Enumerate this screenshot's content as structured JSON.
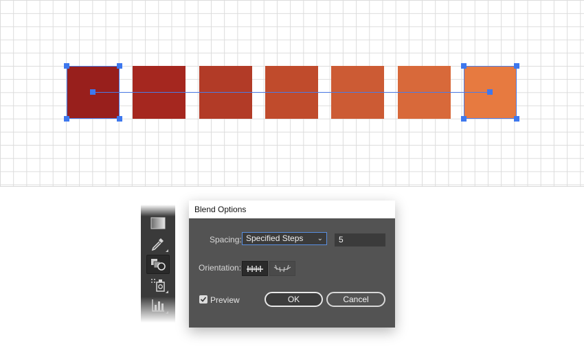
{
  "canvas": {
    "blend_colors": [
      "#981f1c",
      "#a5271f",
      "#b23b27",
      "#c04b2c",
      "#cc5b34",
      "#d8693a",
      "#e77a40"
    ],
    "selection_color": "#3e78ee"
  },
  "toolbar": {
    "tools": [
      "gradient-tool-icon",
      "eyedropper-tool-icon",
      "blend-tool-icon",
      "symbol-sprayer-tool-icon",
      "column-graph-tool-icon"
    ],
    "active_tool": "blend-tool-icon"
  },
  "dialog": {
    "title": "Blend Options",
    "spacing_label": "Spacing:",
    "spacing_value": "Specified Steps",
    "steps_value": "5",
    "orientation_label": "Orientation:",
    "orientation_selected": "align-to-page",
    "preview_label": "Preview",
    "preview_checked": true,
    "ok_label": "OK",
    "cancel_label": "Cancel"
  }
}
